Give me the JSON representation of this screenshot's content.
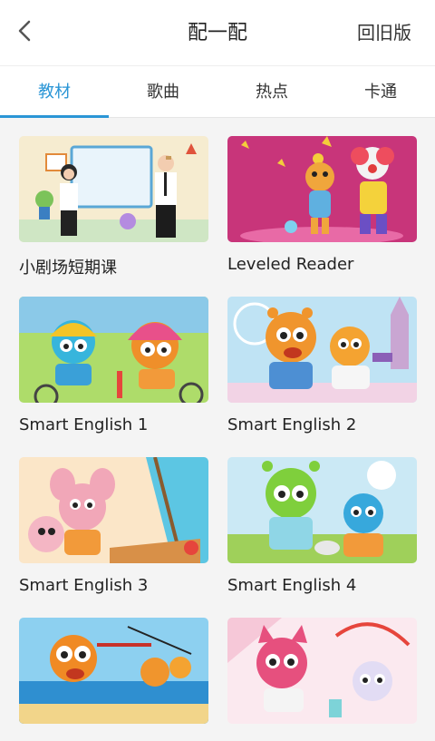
{
  "header": {
    "title": "配一配",
    "old_version_label": "回旧版"
  },
  "tabs": [
    {
      "label": "教材",
      "active": true
    },
    {
      "label": "歌曲",
      "active": false
    },
    {
      "label": "热点",
      "active": false
    },
    {
      "label": "卡通",
      "active": false
    }
  ],
  "colors": {
    "accent": "#2b96d6"
  },
  "courses": [
    {
      "label": "小剧场短期课"
    },
    {
      "label": "Leveled Reader"
    },
    {
      "label": "Smart English 1"
    },
    {
      "label": "Smart English 2"
    },
    {
      "label": "Smart English 3"
    },
    {
      "label": "Smart English 4"
    },
    {
      "label": ""
    },
    {
      "label": ""
    }
  ]
}
